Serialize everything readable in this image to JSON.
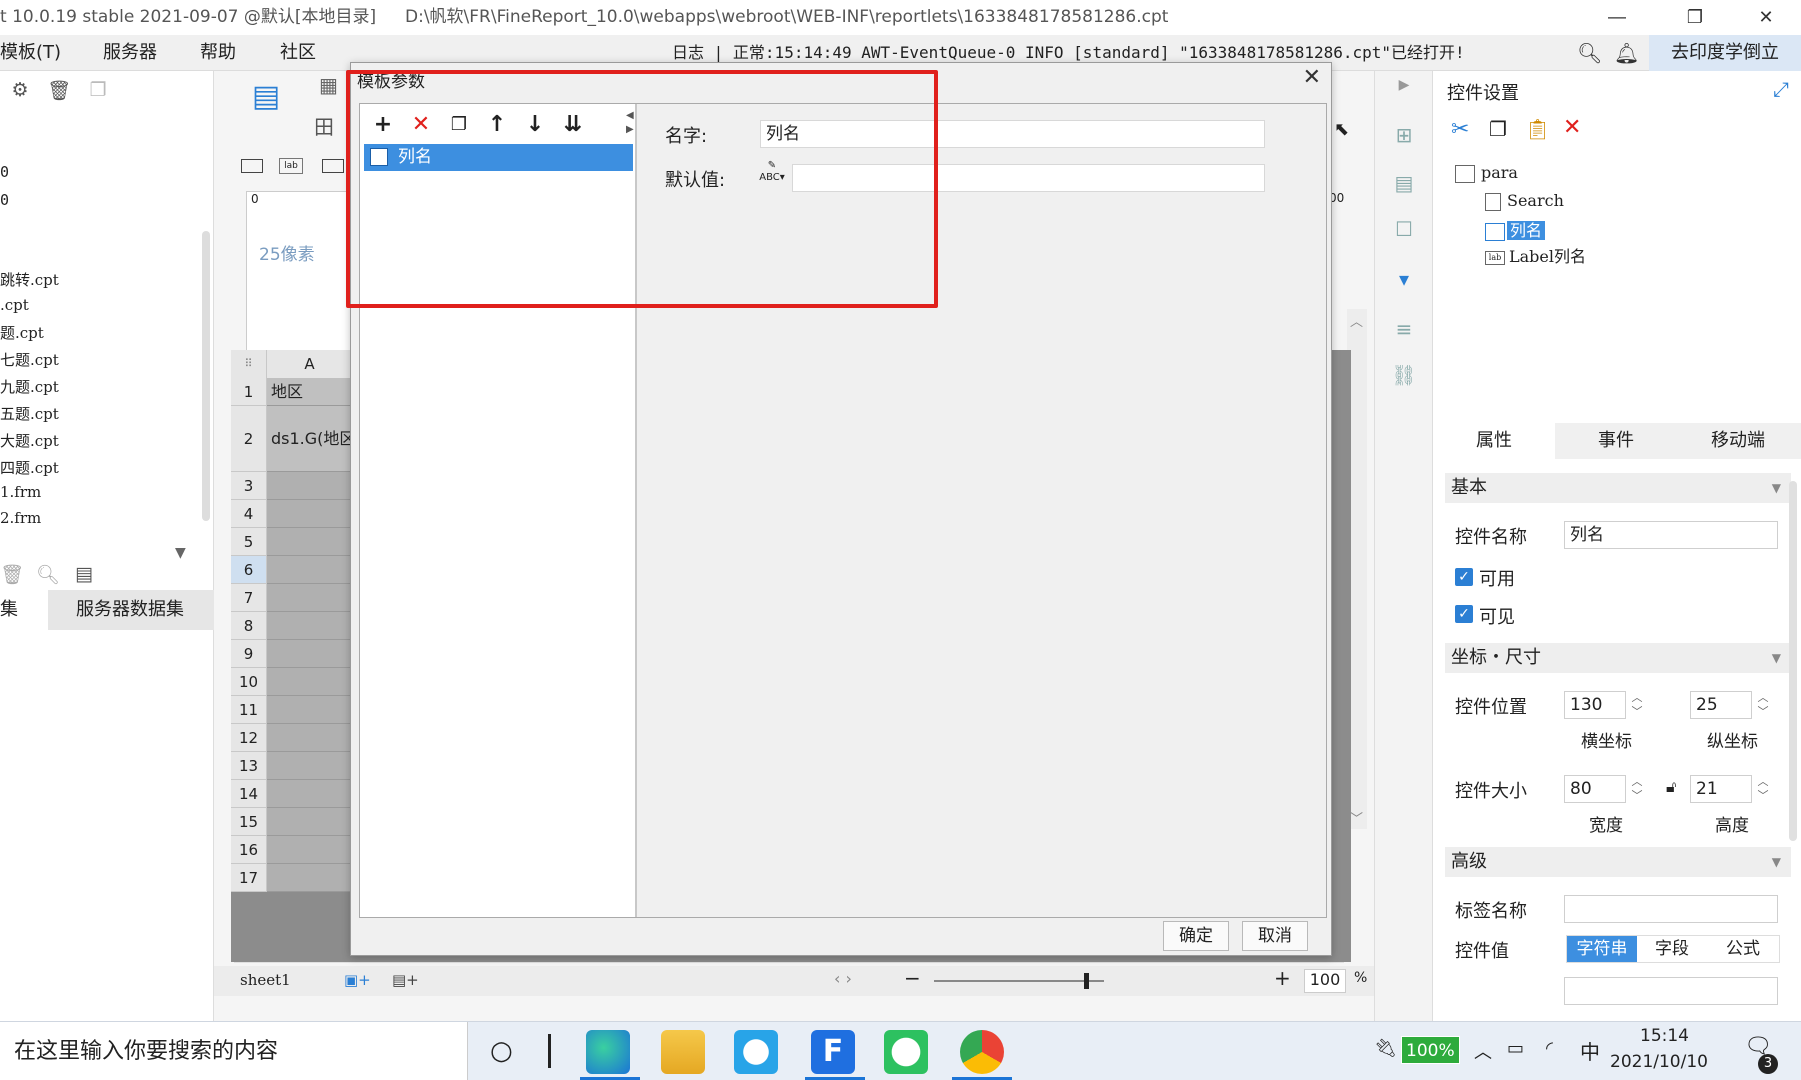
{
  "window": {
    "title": "t 10.0.19 stable 2021-09-07 @默认[本地目录]",
    "path": "D:\\帆软\\FR\\FineReport_10.0\\webapps\\webroot\\WEB-INF\\reportlets\\1633848178581286.cpt",
    "minimize_icon": "minimize-icon",
    "maximize_icon": "restore-icon",
    "close_icon": "close-icon"
  },
  "menubar": {
    "items": [
      "模板(T)",
      "服务器",
      "帮助",
      "社区"
    ],
    "log_label": "日志",
    "log_text": "正常:15:14:49 AWT-EventQueue-0 INFO [standard] \"1633848178581286.cpt\"已经打开!",
    "learn_label": "去印度学倒立"
  },
  "left_panel": {
    "files": [
      "跳转.cpt",
      ".cpt",
      "题.cpt",
      "七题.cpt",
      "九题.cpt",
      "五题.cpt",
      "大题.cpt",
      "四题.cpt",
      "1.frm",
      "2.frm"
    ],
    "partial_lines": [
      "0",
      "0"
    ],
    "tabs": [
      "集",
      "服务器数据集"
    ]
  },
  "center": {
    "px_label": "25像素",
    "ruler_zero": "0",
    "ruler_right": "00",
    "column_header": "A",
    "rows": [
      {
        "n": "1",
        "a": "地区"
      },
      {
        "n": "2",
        "a": "ds1.G(地区"
      },
      {
        "n": "3",
        "a": ""
      },
      {
        "n": "4",
        "a": ""
      },
      {
        "n": "5",
        "a": ""
      },
      {
        "n": "6",
        "a": ""
      },
      {
        "n": "7",
        "a": ""
      },
      {
        "n": "8",
        "a": ""
      },
      {
        "n": "9",
        "a": ""
      },
      {
        "n": "10",
        "a": ""
      },
      {
        "n": "11",
        "a": ""
      },
      {
        "n": "12",
        "a": ""
      },
      {
        "n": "13",
        "a": ""
      },
      {
        "n": "14",
        "a": ""
      },
      {
        "n": "15",
        "a": ""
      },
      {
        "n": "16",
        "a": ""
      },
      {
        "n": "17",
        "a": ""
      }
    ],
    "sheet_tab": "sheet1",
    "zoom": "100",
    "zoom_unit": "%"
  },
  "right_panel": {
    "title": "控件设置",
    "tree": {
      "root": "para",
      "children": [
        "Search",
        "列名",
        "Label列名"
      ],
      "selected": "列名"
    },
    "tabs": [
      "属性",
      "事件",
      "移动端"
    ],
    "sections": {
      "basic": "基本",
      "coords": "坐标・尺寸",
      "advanced": "高级"
    },
    "control_name_label": "控件名称",
    "control_name_value": "列名",
    "enabled_label": "可用",
    "visible_label": "可见",
    "position_label": "控件位置",
    "x_value": "130",
    "y_value": "25",
    "x_label": "横坐标",
    "y_label": "纵坐标",
    "size_label": "控件大小",
    "width_value": "80",
    "height_value": "21",
    "width_label": "宽度",
    "height_label": "高度",
    "tag_name_label": "标签名称",
    "tag_name_value": "",
    "control_value_label": "控件值",
    "value_types": [
      "字符串",
      "字段",
      "公式"
    ]
  },
  "dialog": {
    "title": "模板参数",
    "param_item": "列名",
    "name_label": "名字:",
    "name_value": "列名",
    "default_label": "默认值:",
    "default_value": "",
    "ok": "确定",
    "cancel": "取消"
  },
  "taskbar": {
    "search_placeholder": "在这里输入你要搜索的内容",
    "battery": "100%",
    "ime": "中",
    "time": "15:14",
    "date": "2021/10/10",
    "notifications": "3"
  },
  "colors": {
    "accent": "#3d8fe0",
    "highlight_box": "#e0201c",
    "delete_red": "#e0201c",
    "chk_blue": "#2b7fd4"
  }
}
